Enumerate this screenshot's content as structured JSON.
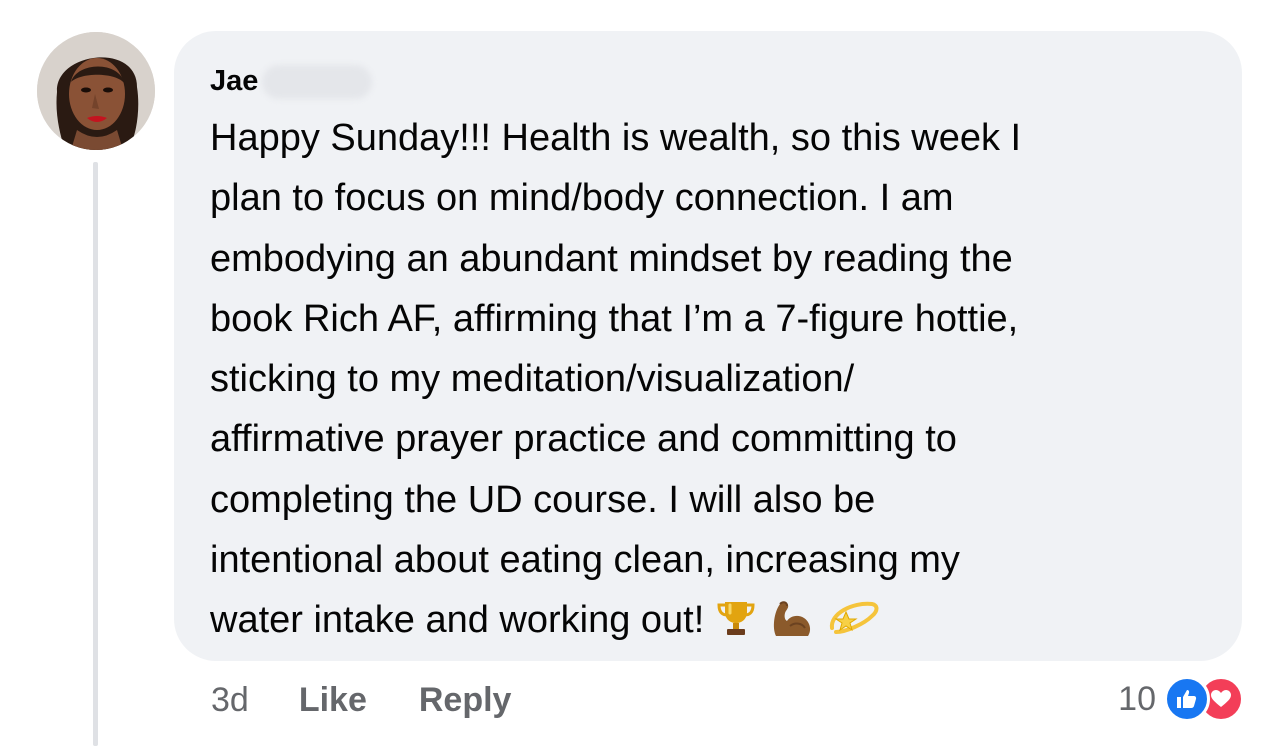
{
  "comment": {
    "author": "Jae",
    "text": "Happy Sunday!!! Health is wealth, so this week I\nplan to focus on mind/body connection. I am\nembodying an abundant mindset by reading the\nbook Rich AF, affirming that I’m a 7-figure hottie,\nsticking to my meditation/visualization/\naffirmative prayer practice and committing to\ncompleting the UD course. I will also be\nintentional about eating clean, increasing my\nwater intake and working out!",
    "emojis": [
      "trophy-icon",
      "flexed-biceps-icon",
      "dizzy-star-icon"
    ]
  },
  "meta": {
    "time": "3d",
    "like_label": "Like",
    "reply_label": "Reply"
  },
  "reactions": {
    "count": "10",
    "types": [
      "like-icon",
      "love-icon"
    ],
    "colors": {
      "like": "#1877f2",
      "love": "#f33e58"
    }
  },
  "colors": {
    "bubble": "#f0f2f5",
    "secondary_text": "#65676b",
    "thread_line": "#dfe1e5"
  }
}
